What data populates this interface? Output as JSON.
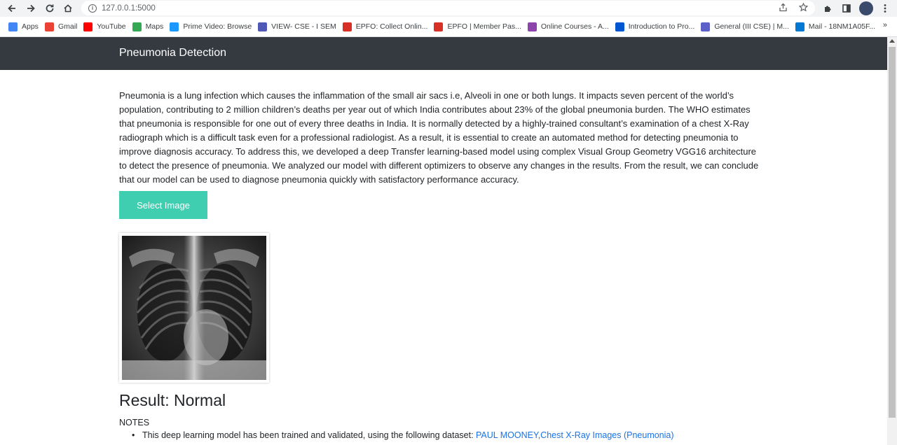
{
  "browser": {
    "url": "127.0.0.1:5000",
    "bookmarks": [
      {
        "label": "Apps",
        "icon": "apps-grid-icon",
        "color": "#4285f4"
      },
      {
        "label": "Gmail",
        "icon": "gmail-icon",
        "color": "#ea4335"
      },
      {
        "label": "YouTube",
        "icon": "youtube-icon",
        "color": "#ff0000"
      },
      {
        "label": "Maps",
        "icon": "maps-icon",
        "color": "#34a853"
      },
      {
        "label": "Prime Video: Browse",
        "icon": "prime-video-icon",
        "color": "#1a98ff"
      },
      {
        "label": "VIEW- CSE - I SEM",
        "icon": "view-icon",
        "color": "#5058b5"
      },
      {
        "label": "EPFO: Collect Onlin...",
        "icon": "epfo-icon",
        "color": "#d93025"
      },
      {
        "label": "EPFO | Member Pas...",
        "icon": "epfo-member-icon",
        "color": "#d93025"
      },
      {
        "label": "Online Courses - A...",
        "icon": "online-courses-icon",
        "color": "#8e44ad"
      },
      {
        "label": "Introduction to Pro...",
        "icon": "coursera-icon",
        "color": "#0056d2"
      },
      {
        "label": "General (III CSE) | M...",
        "icon": "teams-icon",
        "color": "#5b5fc7"
      },
      {
        "label": "Mail - 18NM1A05F...",
        "icon": "outlook-icon",
        "color": "#0078d4"
      }
    ]
  },
  "navbar": {
    "brand": "Pneumonia Detection"
  },
  "main": {
    "description": "Pneumonia is a lung infection which causes the inflammation of the small air sacs i.e, Alveoli in one or both lungs. It impacts seven percent of the world’s population, contributing to 2 million children’s deaths per year out of which India contributes about 23% of the global pneumonia burden. The WHO estimates that pneumonia is responsible for one out of every three deaths in India. It is normally detected by a highly-trained consultant’s examination of a chest X-Ray radiograph which is a difficult task even for a professional radiologist. As a result, it is essential to create an automated method for detecting pneumonia to improve diagnosis accuracy. To address this, we developed a deep Transfer learning-based model using complex Visual Group Geometry VGG16 architecture to detect the presence of pneumonia. We analyzed our model with different optimizers to observe any changes in the results. From the result, we can conclude that our model can be used to diagnose pneumonia quickly with satisfactory performance accuracy.",
    "select_button": "Select Image",
    "result_label": "Result:",
    "result_value": "Normal",
    "notes_title": "NOTES",
    "notes": {
      "text": "This deep learning model has been trained and validated, using the following dataset: ",
      "link": "PAUL MOONEY,Chest X-Ray Images (Pneumonia)"
    }
  },
  "colors": {
    "navbar_bg": "#343a40",
    "button_bg": "#3fcfb0",
    "link": "#1a73e8"
  }
}
